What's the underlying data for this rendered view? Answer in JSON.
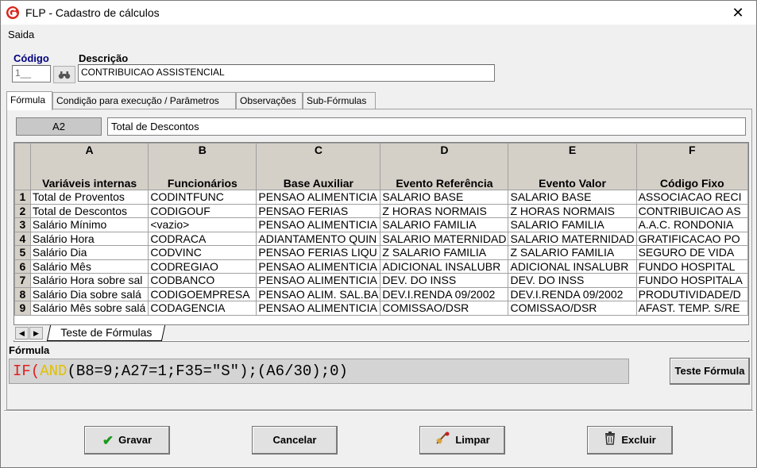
{
  "window": {
    "title": "FLP - Cadastro de cálculos",
    "close_glyph": "✕"
  },
  "menu": {
    "exit": "Saida"
  },
  "header": {
    "codigo_label": "Código",
    "codigo_value": "1__",
    "descricao_label": "Descrição",
    "descricao_value": "CONTRIBUICAO ASSISTENCIAL"
  },
  "tabs": [
    {
      "label": "Fórmula",
      "active": true
    },
    {
      "label": "Condição para execução / Parâmetros"
    },
    {
      "label": "Observações"
    },
    {
      "label": "Sub-Fórmulas"
    }
  ],
  "sheet": {
    "cell_ref": "A2",
    "cell_content": "Total de Descontos",
    "columns": [
      {
        "letter": "A",
        "name": "Variáveis internas"
      },
      {
        "letter": "B",
        "name": "Funcionários"
      },
      {
        "letter": "C",
        "name": "Base Auxiliar"
      },
      {
        "letter": "D",
        "name": "Evento Referência"
      },
      {
        "letter": "E",
        "name": "Evento Valor"
      },
      {
        "letter": "F",
        "name": "Código Fixo"
      }
    ],
    "rows": [
      [
        "1",
        "Total de Proventos",
        "CODINTFUNC",
        "PENSAO ALIMENTICIA",
        "SALARIO BASE",
        "SALARIO BASE",
        "ASSOCIACAO RECI"
      ],
      [
        "2",
        "Total de Descontos",
        "CODIGOUF",
        "PENSAO FERIAS",
        "Z HORAS NORMAIS",
        "Z HORAS NORMAIS",
        "CONTRIBUICAO AS"
      ],
      [
        "3",
        "Salário Mínimo",
        "<vazio>",
        "PENSAO ALIMENTICIA",
        "SALARIO FAMILIA",
        "SALARIO FAMILIA",
        "A.A.C. RONDONIA"
      ],
      [
        "4",
        "Salário Hora",
        "CODRACA",
        "ADIANTAMENTO QUIN",
        "SALARIO MATERNIDAD",
        "SALARIO MATERNIDAD",
        "GRATIFICACAO PO"
      ],
      [
        "5",
        "Salário Dia",
        "CODVINC",
        "PENSAO FERIAS LIQU",
        "Z SALARIO FAMILIA",
        "Z SALARIO FAMILIA",
        "SEGURO DE VIDA"
      ],
      [
        "6",
        "Salário Mês",
        "CODREGIAO",
        "PENSAO ALIMENTICIA",
        "ADICIONAL INSALUBR",
        "ADICIONAL INSALUBR",
        "FUNDO HOSPITAL"
      ],
      [
        "7",
        "Salário Hora sobre sal",
        "CODBANCO",
        "PENSAO ALIMENTICIA",
        "DEV. DO INSS",
        "DEV. DO INSS",
        "FUNDO HOSPITALA"
      ],
      [
        "8",
        "Salário Dia sobre salá",
        "CODIGOEMPRESA",
        "PENSAO ALIM. SAL.BA",
        "DEV.I.RENDA 09/2002",
        "DEV.I.RENDA 09/2002",
        "PRODUTIVIDADE/D"
      ],
      [
        "9",
        "Salário Mês sobre salá",
        "CODAGENCIA",
        "PENSAO ALIMENTICIA",
        "COMISSAO/DSR",
        "COMISSAO/DSR",
        "AFAST. TEMP. S/RE"
      ]
    ],
    "sheet_tab": "Teste de Fórmulas"
  },
  "formula": {
    "label": "Fórmula",
    "part_if": "IF",
    "part_paren": "(",
    "part_and": "AND",
    "part_rest": "(B8=9;A27=1;F35=\"S\");(A6/30);0)",
    "test_button": "Teste Fórmula"
  },
  "buttons": {
    "save": "Gravar",
    "cancel": "Cancelar",
    "clear": "Limpar",
    "delete": "Excluir"
  }
}
